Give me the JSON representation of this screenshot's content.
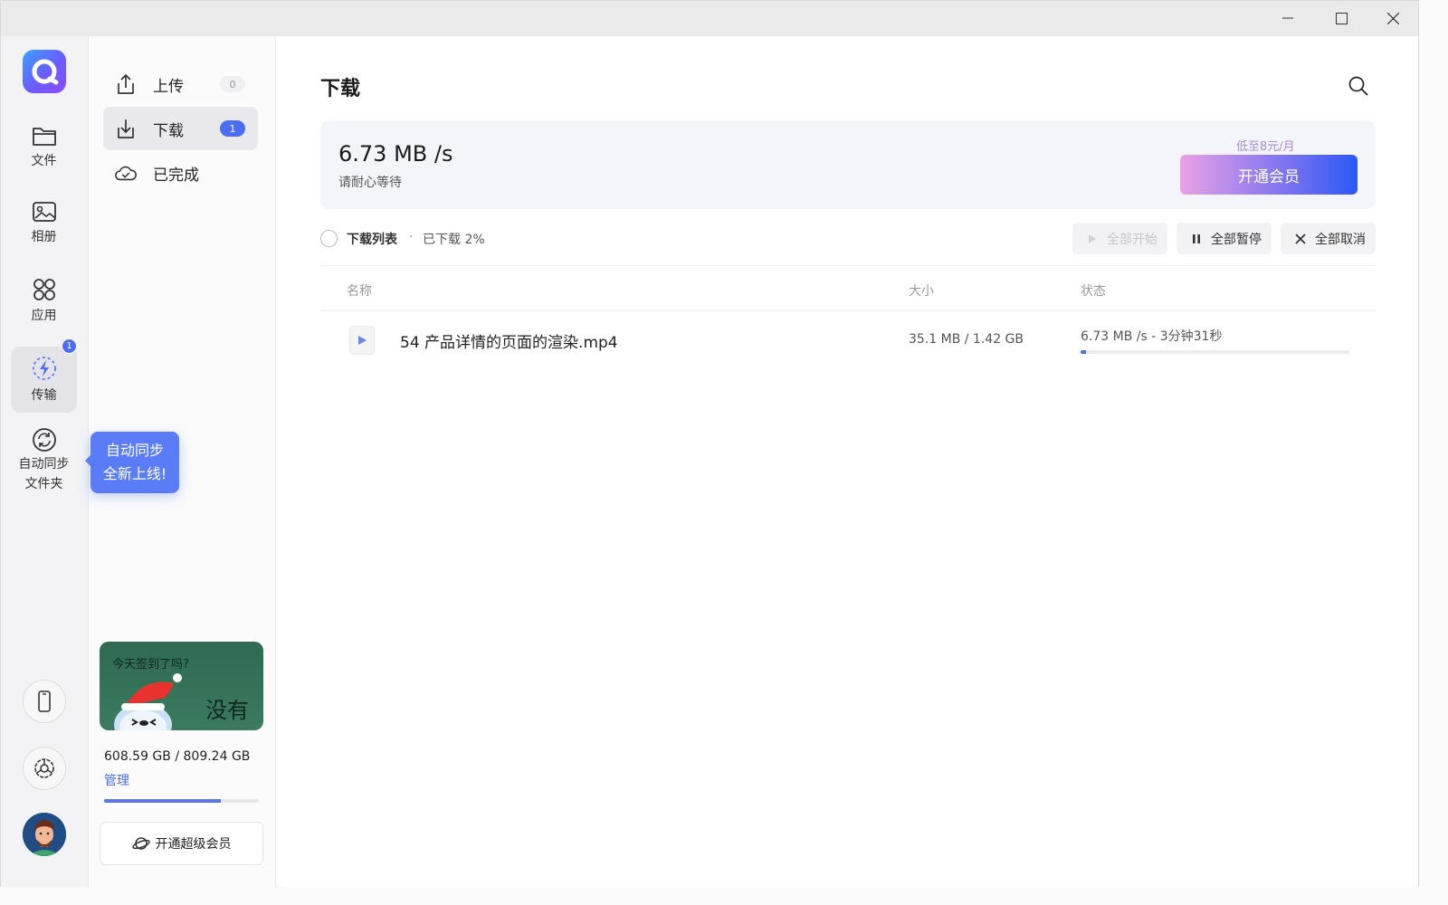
{
  "colors": {
    "accent": "#4b6cf5",
    "tooltip": "#5a7cf7",
    "vip_gradient_start": "#e9a2e4",
    "vip_gradient_end": "#2b58f5"
  },
  "rail": {
    "items": [
      {
        "label": "文件",
        "icon": "folder-icon"
      },
      {
        "label": "相册",
        "icon": "photo-album-icon"
      },
      {
        "label": "应用",
        "icon": "apps-grid-icon"
      },
      {
        "label": "传输",
        "icon": "transfer-lightning-icon",
        "badge": "1",
        "active": true
      },
      {
        "label": "自动同步\n文件夹",
        "label_line1": "自动同步",
        "label_line2": "文件夹",
        "icon": "sync-icon"
      }
    ],
    "bottom_icons": [
      "phone-icon",
      "settings-icon"
    ],
    "tooltip": {
      "line1": "自动同步",
      "line2": "全新上线!"
    }
  },
  "sidebar": {
    "items": [
      {
        "label": "上传",
        "icon": "upload-icon",
        "count": "0"
      },
      {
        "label": "下载",
        "icon": "download-icon",
        "count": "1",
        "active": true
      },
      {
        "label": "已完成",
        "icon": "cloud-done-icon"
      }
    ],
    "checkin": {
      "question": "今天签到了吗?",
      "answer": "没有"
    },
    "storage": {
      "text": "608.59 GB / 809.24 GB",
      "used_fraction": 0.752,
      "manage_label": "管理"
    },
    "vip_button": "开通超级会员"
  },
  "main": {
    "title": "下载",
    "speed": {
      "value": "6.73 MB /s",
      "hint": "请耐心等待"
    },
    "promo": {
      "note": "低至8元/月",
      "button": "开通会员"
    },
    "list": {
      "title": "下载列表",
      "separator": "·",
      "progress": "已下载 2%",
      "actions": {
        "start": "全部开始",
        "pause": "全部暂停",
        "cancel": "全部取消"
      }
    },
    "columns": {
      "name": "名称",
      "size": "大小",
      "status": "状态"
    },
    "files": [
      {
        "name": "54 产品详情的页面的渲染.mp4",
        "size": "35.1 MB / 1.42 GB",
        "status": "6.73 MB /s - 3分钟31秒",
        "progress_fraction": 0.02
      }
    ]
  }
}
